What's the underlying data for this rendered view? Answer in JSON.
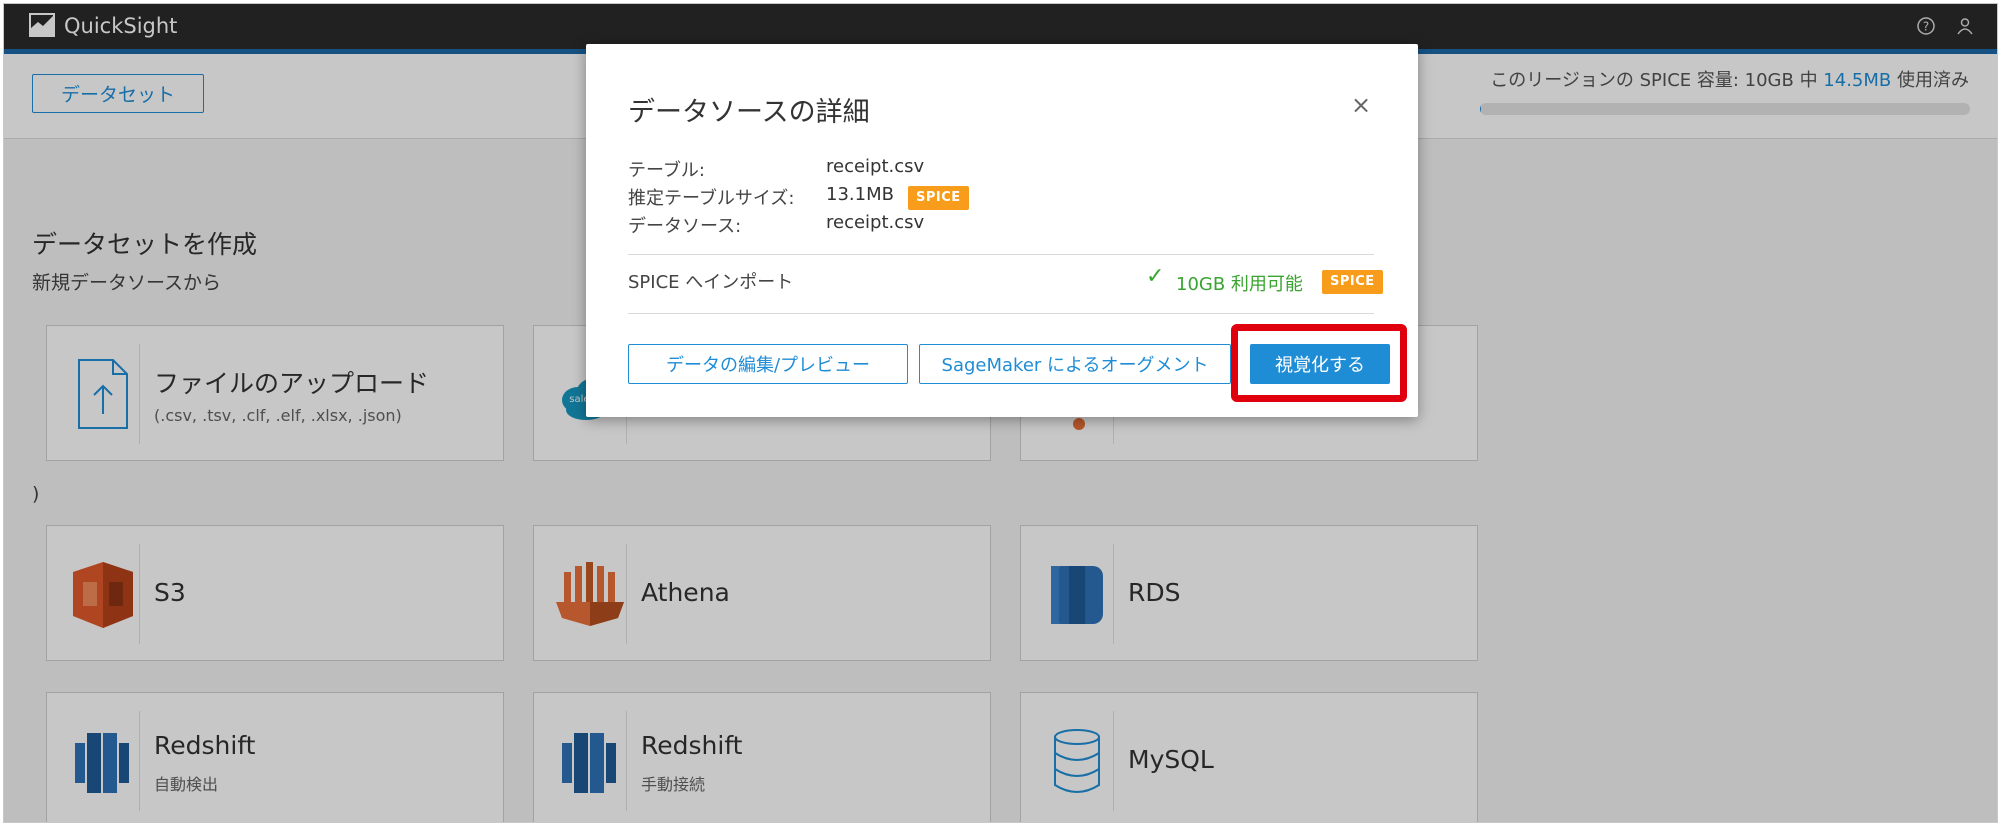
{
  "app": {
    "title": "QuickSight"
  },
  "header": {
    "dataset_button": "データセット"
  },
  "spice": {
    "prefix": "このリージョンの SPICE 容量: 10GB 中 ",
    "used": "14.5MB",
    "suffix": " 使用済み",
    "used_fraction": 0.0014
  },
  "main": {
    "title": "データセットを作成",
    "subtitle": "新規データソースから",
    "stray_text": ")",
    "cards": {
      "upload": {
        "title": "ファイルのアップロード",
        "sub": "(.csv, .tsv, .clf, .elf, .xlsx, .json)"
      },
      "salesforce": {
        "icon_text": "sales"
      },
      "s3": {
        "title": "S3"
      },
      "athena": {
        "title": "Athena"
      },
      "rds": {
        "title": "RDS"
      },
      "redshift_auto": {
        "title": "Redshift",
        "sub": "自動検出"
      },
      "redshift_manual": {
        "title": "Redshift",
        "sub": "手動接続"
      },
      "mysql": {
        "title": "MySQL"
      }
    }
  },
  "modal": {
    "title": "データソースの詳細",
    "close": "×",
    "table_label": "テーブル:",
    "table_value": "receipt.csv",
    "size_label": "推定テーブルサイズ:",
    "size_value": "13.1MB",
    "source_label": "データソース:",
    "source_value": "receipt.csv",
    "badge": "SPICE",
    "import_label": "SPICE へインポート",
    "available_check": "✓",
    "available": "10GB 利用可能",
    "edit_preview": "データの編集/プレビュー",
    "sagemaker": "SageMaker によるオーグメント",
    "visualize": "視覚化する"
  },
  "colors": {
    "accent": "#1f8dd6",
    "badge": "#f89c1c",
    "success": "#3aa430",
    "highlight": "#e0000d"
  }
}
